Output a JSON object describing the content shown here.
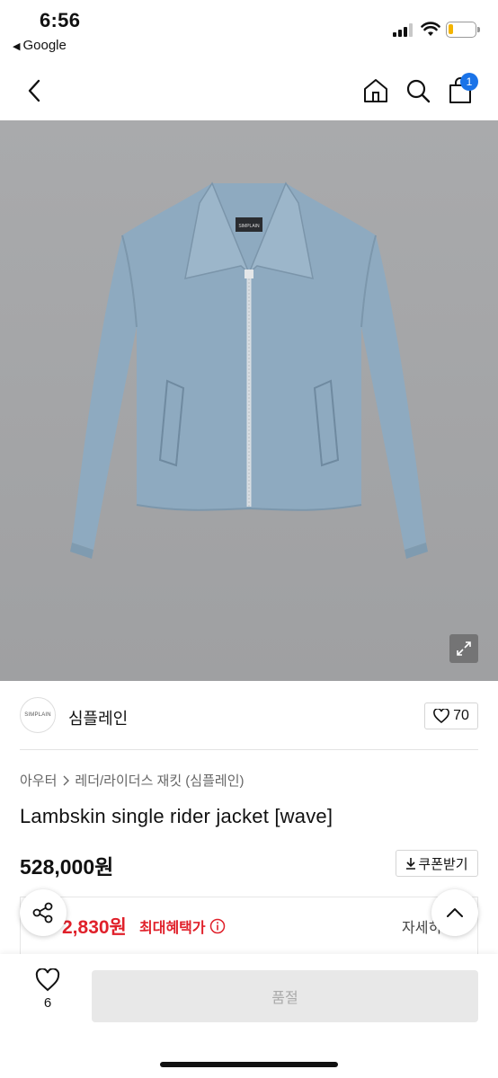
{
  "status_bar": {
    "time": "6:56",
    "back_app": "Google"
  },
  "nav": {
    "cart_badge": "1",
    "icons": [
      "back-chevron-icon",
      "home-icon",
      "search-icon",
      "cart-icon"
    ]
  },
  "product": {
    "brand_logo_text": "SIMPLAIN",
    "brand_name": "심플레인",
    "like_count": "70",
    "breadcrumb": [
      "아우터",
      "레더/라이더스 재킷 (심플레인)"
    ],
    "title": "Lambskin single rider jacket [wave]",
    "price": "528,000원",
    "coupon_label": "쿠폰받기",
    "benefit_price": "2,830원",
    "benefit_label": "최대혜택가",
    "benefit_detail": "자세히",
    "image_label_tag": "SIMPLAIN"
  },
  "bottom_bar": {
    "wish_count": "6",
    "soldout_label": "품절"
  },
  "colors": {
    "accent_red": "#e0202a",
    "badge_blue": "#1a73e8",
    "jacket_blue": "#8eaac0",
    "image_bg": "#a7a8aa"
  }
}
